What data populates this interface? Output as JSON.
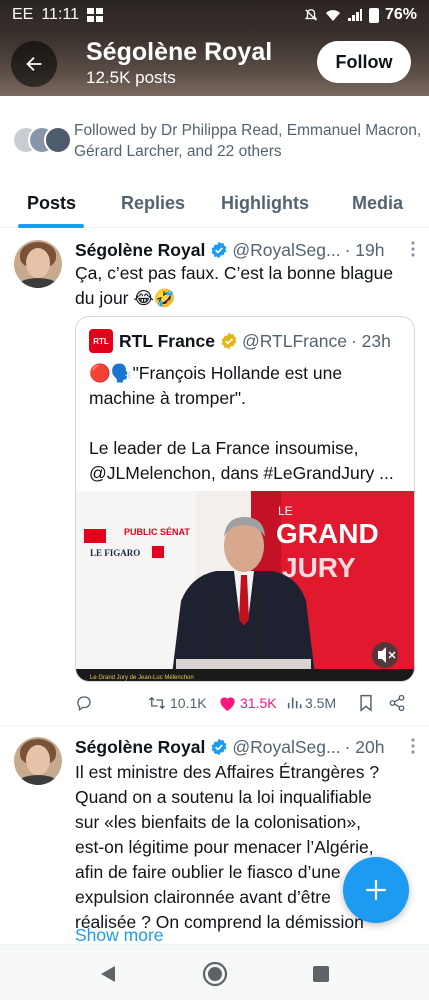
{
  "status_bar": {
    "carrier": "EE",
    "time": "11:11",
    "battery": "76%"
  },
  "header": {
    "name": "Ségolène Royal",
    "posts": "12.5K posts",
    "follow_label": "Follow"
  },
  "followed_by": {
    "text": "Followed by Dr Philippa Read, Emmanuel Macron, Gérard Larcher, and 22 others"
  },
  "tabs": [
    {
      "label": "Posts",
      "active": true
    },
    {
      "label": "Replies",
      "active": false
    },
    {
      "label": "Highlights",
      "active": false
    },
    {
      "label": "Media",
      "active": false
    }
  ],
  "tweets": [
    {
      "name": "Ségolène Royal",
      "handle": "@RoyalSeg...",
      "time": "· 19h",
      "text_lines": [
        "Ça, c’est pas faux. C’est la bonne blague",
        "du jour 😂🤣"
      ],
      "quote": {
        "name": "RTL France",
        "handle": "@RTLFrance",
        "time": "· 23h",
        "logo_text": "RTL",
        "text_lines": [
          "🔴🗣️\"François Hollande est une",
          "machine à tromper\".",
          "",
          "Le leader de La France insoumise,",
          "@JLMelenchon, dans #LeGrandJury ..."
        ],
        "media": {
          "show_left": "PUBLIC SÉNAT",
          "paper": "LE FIGARO",
          "title_top": "LE",
          "title_mid": "GRAND",
          "title_bot": "JURY",
          "caption": "Le Grand Jury de Jean-Luc Mélenchon"
        }
      },
      "stats": {
        "retweets": "10.1K",
        "likes": "31.5K",
        "views": "3.5M"
      }
    },
    {
      "name": "Ségolène Royal",
      "handle": "@RoyalSeg...",
      "time": "· 20h",
      "text_lines": [
        "Il est ministre des Affaires Étrangères ?",
        "Quand on a soutenu la loi inqualifiable",
        "sur «les bienfaits de la colonisation»,",
        "est-on légitime pour menacer l’Algérie,",
        "afin de faire oublier le fiasco d’une",
        "expulsion claironnée avant d’être",
        "réalisée ? On comprend la démission"
      ],
      "show_more": "Show more"
    }
  ],
  "icons": {
    "back": "arrow-left-icon",
    "verified": "verified-badge-icon",
    "compose": "plus-icon"
  },
  "colors": {
    "accent": "#1d9bf0",
    "like": "#f91880",
    "secondary_text": "#536471"
  }
}
